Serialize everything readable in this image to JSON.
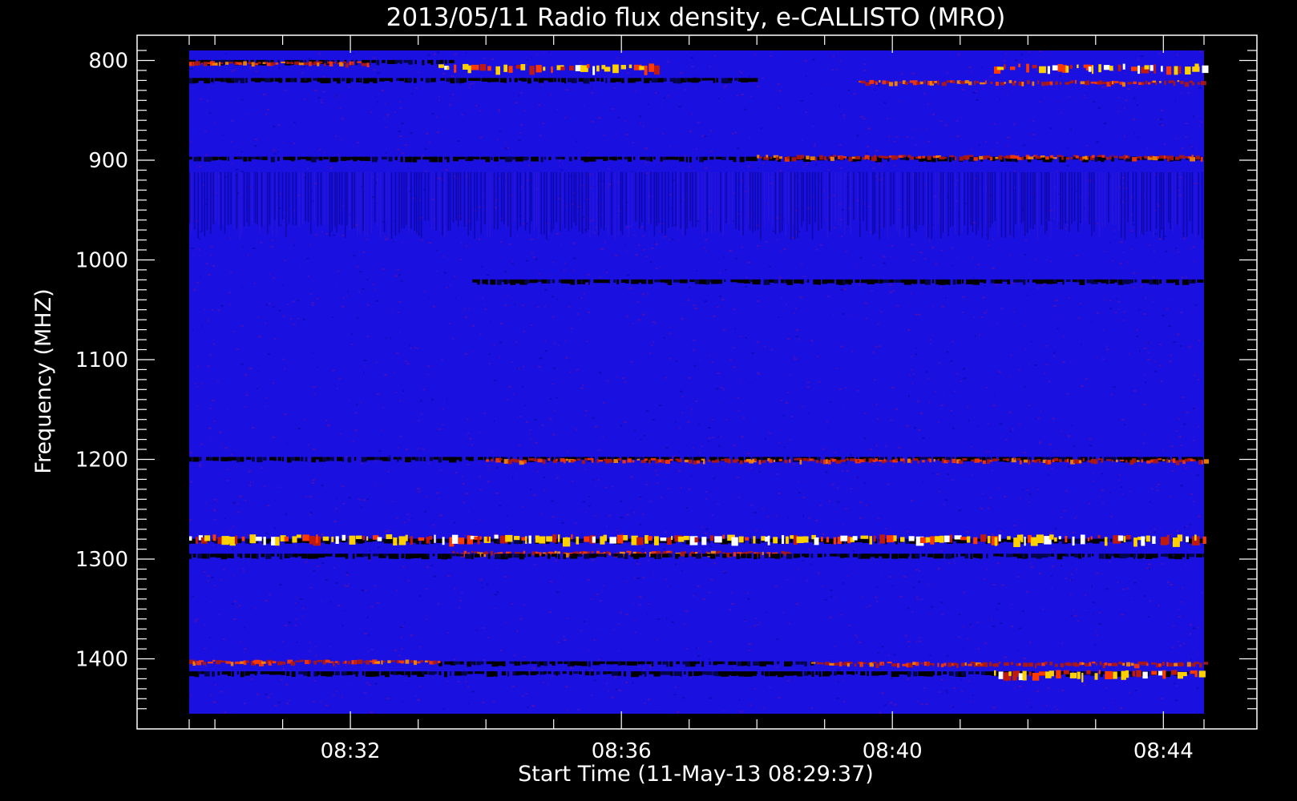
{
  "chart_data": {
    "type": "heatmap",
    "title": "2013/05/11  Radio flux density, e-CALLISTO (MRO)",
    "xlabel": "Start Time (11-May-13 08:29:37)",
    "ylabel": "Frequency (MHZ)",
    "x_ticks": [
      "08:32",
      "08:36",
      "08:40",
      "08:44"
    ],
    "x_tick_minutes": [
      32,
      36,
      40,
      44
    ],
    "x_range_minutes": [
      29.62,
      44.6
    ],
    "y_ticks": [
      800,
      900,
      1000,
      1100,
      1200,
      1300,
      1400
    ],
    "y_range": [
      790,
      1455
    ],
    "y_axis_inverted": true,
    "colormap": [
      "#000000",
      "#0000d8",
      "#7a0010",
      "#ff2a00",
      "#ffd000",
      "#ffffff"
    ],
    "background_color": "#1a10e0",
    "features": [
      {
        "kind": "dark_band",
        "freq": 802,
        "t_start": 29.62,
        "t_end": 33.5
      },
      {
        "kind": "emission",
        "freq": 803,
        "t_start": 29.62,
        "t_end": 32.3
      },
      {
        "kind": "dark_band",
        "freq": 820,
        "t_start": 29.62,
        "t_end": 38.0
      },
      {
        "kind": "bursty_emission",
        "freq": 808,
        "t_start": 33.3,
        "t_end": 36.5
      },
      {
        "kind": "bursty_emission",
        "freq": 808,
        "t_start": 41.5,
        "t_end": 44.6
      },
      {
        "kind": "emission",
        "freq": 822,
        "t_start": 39.5,
        "t_end": 44.6
      },
      {
        "kind": "dark_band",
        "freq": 899,
        "t_start": 29.62,
        "t_end": 44.6
      },
      {
        "kind": "emission",
        "freq": 897,
        "t_start": 38.0,
        "t_end": 44.6
      },
      {
        "kind": "striated_band",
        "freq_low": 912,
        "freq_high": 980,
        "t_start": 29.62,
        "t_end": 44.6
      },
      {
        "kind": "dark_band",
        "freq": 1022,
        "t_start": 33.8,
        "t_end": 44.6
      },
      {
        "kind": "dark_band",
        "freq": 1200,
        "t_start": 29.62,
        "t_end": 44.6
      },
      {
        "kind": "emission",
        "freq": 1201,
        "t_start": 34.0,
        "t_end": 44.6
      },
      {
        "kind": "dark_band",
        "freq": 1282,
        "t_start": 29.62,
        "t_end": 44.6
      },
      {
        "kind": "bursty_emission",
        "freq": 1280,
        "t_start": 29.62,
        "t_end": 44.6
      },
      {
        "kind": "emission",
        "freq": 1294,
        "t_start": 33.5,
        "t_end": 38.5
      },
      {
        "kind": "dark_band",
        "freq": 1297,
        "t_start": 29.62,
        "t_end": 44.6
      },
      {
        "kind": "dark_band",
        "freq": 1405,
        "t_start": 33.3,
        "t_end": 38.8
      },
      {
        "kind": "emission",
        "freq": 1403,
        "t_start": 29.62,
        "t_end": 33.3
      },
      {
        "kind": "emission",
        "freq": 1405,
        "t_start": 38.8,
        "t_end": 44.6
      },
      {
        "kind": "dark_band",
        "freq": 1415,
        "t_start": 29.62,
        "t_end": 44.6
      },
      {
        "kind": "bursty_emission",
        "freq": 1416,
        "t_start": 41.5,
        "t_end": 44.6
      }
    ]
  }
}
